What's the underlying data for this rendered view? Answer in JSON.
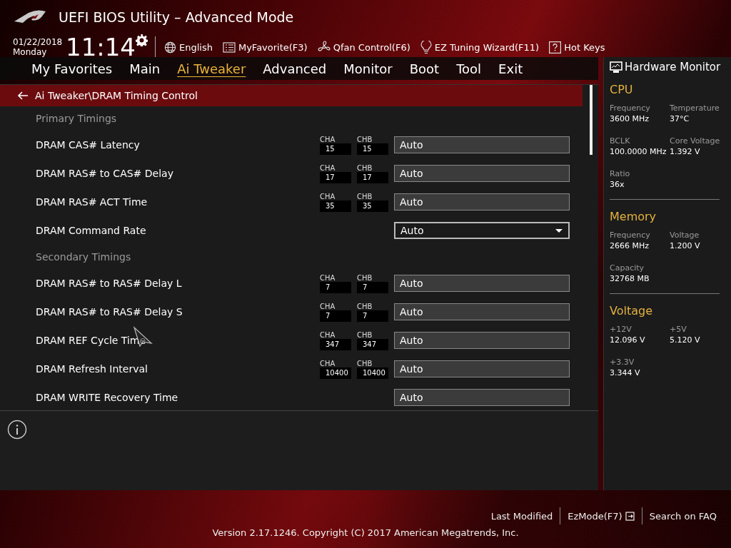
{
  "header": {
    "title": "UEFI BIOS Utility – Advanced Mode",
    "date": "01/22/2018",
    "day": "Monday",
    "time": "11:14",
    "tools": [
      {
        "label": "English"
      },
      {
        "label": "MyFavorite(F3)"
      },
      {
        "label": "Qfan Control(F6)"
      },
      {
        "label": "EZ Tuning Wizard(F11)"
      },
      {
        "label": "Hot Keys"
      }
    ]
  },
  "tabs": [
    {
      "label": "My Favorites",
      "selected": false
    },
    {
      "label": "Main",
      "selected": false
    },
    {
      "label": "Ai Tweaker",
      "selected": true
    },
    {
      "label": "Advanced",
      "selected": false
    },
    {
      "label": "Monitor",
      "selected": false
    },
    {
      "label": "Boot",
      "selected": false
    },
    {
      "label": "Tool",
      "selected": false
    },
    {
      "label": "Exit",
      "selected": false
    }
  ],
  "breadcrumb": "Ai Tweaker\\DRAM Timing Control",
  "settings": [
    {
      "kind": "heading",
      "label": "Primary Timings"
    },
    {
      "kind": "timing",
      "label": "DRAM CAS# Latency",
      "cha_label": "CHA",
      "cha": "15",
      "chb_label": "CHB",
      "chb": "15",
      "value": "Auto"
    },
    {
      "kind": "timing",
      "label": "DRAM RAS# to CAS# Delay",
      "cha_label": "CHA",
      "cha": "17",
      "chb_label": "CHB",
      "chb": "17",
      "value": "Auto"
    },
    {
      "kind": "timing",
      "label": "DRAM RAS# ACT Time",
      "cha_label": "CHA",
      "cha": "35",
      "chb_label": "CHB",
      "chb": "35",
      "value": "Auto"
    },
    {
      "kind": "select",
      "label": "DRAM Command Rate",
      "value": "Auto"
    },
    {
      "kind": "heading",
      "label": "Secondary Timings"
    },
    {
      "kind": "timing",
      "label": "DRAM RAS# to RAS# Delay L",
      "cha_label": "CHA",
      "cha": "7",
      "chb_label": "CHB",
      "chb": "7",
      "value": "Auto"
    },
    {
      "kind": "timing",
      "label": "DRAM RAS# to RAS# Delay S",
      "cha_label": "CHA",
      "cha": "7",
      "chb_label": "CHB",
      "chb": "7",
      "value": "Auto"
    },
    {
      "kind": "timing",
      "label": "DRAM REF Cycle Time",
      "cha_label": "CHA",
      "cha": "347",
      "chb_label": "CHB",
      "chb": "347",
      "value": "Auto"
    },
    {
      "kind": "timing",
      "label": "DRAM Refresh Interval",
      "cha_label": "CHA",
      "cha": "10400",
      "chb_label": "CHB",
      "chb": "10400",
      "value": "Auto"
    },
    {
      "kind": "field",
      "label": "DRAM WRITE Recovery Time",
      "value": "Auto"
    }
  ],
  "monitor": {
    "title": "Hardware Monitor",
    "sections": [
      {
        "title": "CPU",
        "items": [
          {
            "label": "Frequency",
            "value": "3600 MHz"
          },
          {
            "label": "Temperature",
            "value": "37°C"
          },
          {
            "label": "BCLK",
            "value": "100.0000 MHz"
          },
          {
            "label": "Core Voltage",
            "value": "1.392 V"
          },
          {
            "label": "Ratio",
            "value": "36x"
          }
        ]
      },
      {
        "title": "Memory",
        "items": [
          {
            "label": "Frequency",
            "value": "2666 MHz"
          },
          {
            "label": "Voltage",
            "value": "1.200 V"
          },
          {
            "label": "Capacity",
            "value": "32768 MB"
          }
        ]
      },
      {
        "title": "Voltage",
        "items": [
          {
            "label": "+12V",
            "value": "12.096 V"
          },
          {
            "label": "+5V",
            "value": "5.120 V"
          },
          {
            "label": "+3.3V",
            "value": "3.344 V"
          }
        ]
      }
    ]
  },
  "footer": {
    "links": [
      "Last Modified",
      "EzMode(F7)",
      "Search on FAQ"
    ],
    "version": "Version 2.17.1246. Copyright (C) 2017 American Megatrends, Inc."
  }
}
